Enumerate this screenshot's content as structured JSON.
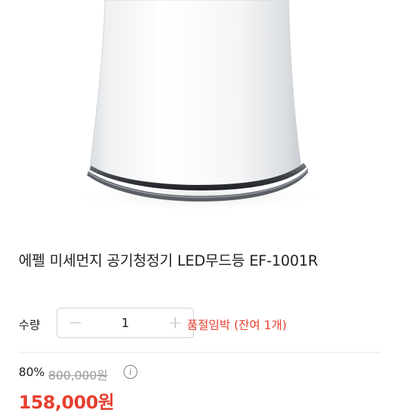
{
  "product": {
    "title": "에펠 미세먼지 공기청정기 LED무드등 EF-1001R",
    "image_alt": "product-photo-air-purifier"
  },
  "quantity": {
    "label": "수량",
    "value": "1",
    "minus": "−",
    "plus": "+"
  },
  "stock_status": "품절임박 (잔여 1개)",
  "price": {
    "discount": "80%",
    "original": "800,000원",
    "info": "i",
    "sale": "158,000원"
  },
  "colors": {
    "accent_red": "#e8402f",
    "text": "#222222",
    "muted": "#9a9a9a"
  }
}
